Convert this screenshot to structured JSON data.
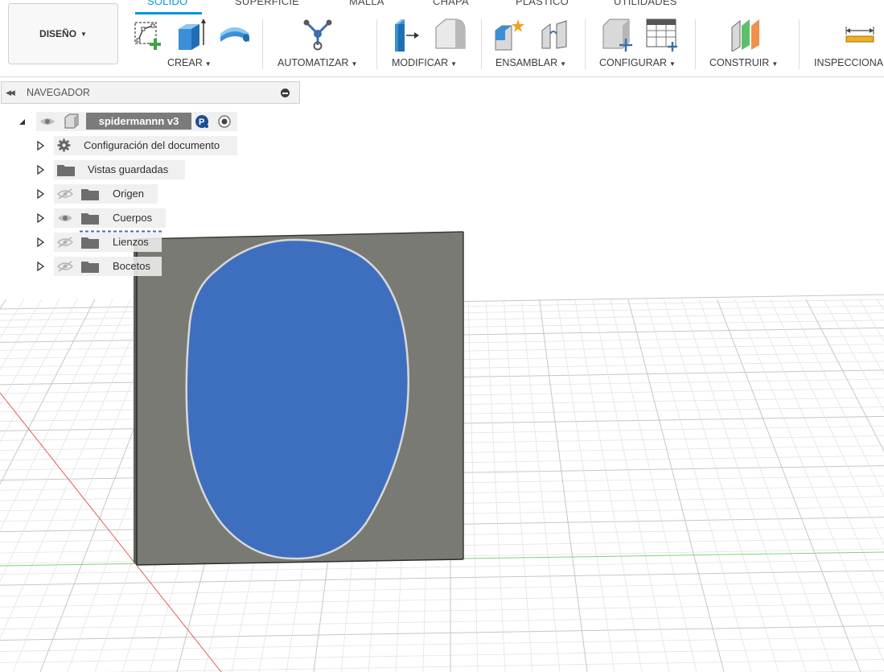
{
  "toolbar": {
    "workspace_button": "DISEÑO",
    "tabs": [
      "SÓLIDO",
      "SUPERFICIE",
      "MALLA",
      "CHAPA",
      "PLÁSTICO",
      "UTILIDADES"
    ],
    "active_tab": "SÓLIDO",
    "groups": {
      "crear": "CREAR",
      "automatizar": "AUTOMATIZAR",
      "modificar": "MODIFICAR",
      "ensamblar": "ENSAMBLAR",
      "configurar": "CONFIGURAR",
      "construir": "CONSTRUIR",
      "inspeccionar": "INSPECCIONA"
    },
    "accent_color": "#0696d7"
  },
  "navigator": {
    "title": "NAVEGADOR",
    "root": {
      "name": "spidermannn v3",
      "badge": "P"
    },
    "items": [
      {
        "label": "Configuración del documento",
        "icon": "gear-icon",
        "visibility": "none"
      },
      {
        "label": "Vistas guardadas",
        "icon": "folder-icon",
        "visibility": "none"
      },
      {
        "label": "Origen",
        "icon": "folder-icon",
        "visibility": "hidden"
      },
      {
        "label": "Cuerpos",
        "icon": "folder-icon",
        "visibility": "visible"
      },
      {
        "label": "Lienzos",
        "icon": "folder-icon",
        "visibility": "hidden"
      },
      {
        "label": "Bocetos",
        "icon": "folder-icon",
        "visibility": "hidden"
      }
    ]
  },
  "viewport": {
    "body_color": "#7a7a74",
    "face_color": "#3e6fbf",
    "x_axis_color": "#e05a5a",
    "z_axis_color": "#7bd37b"
  }
}
